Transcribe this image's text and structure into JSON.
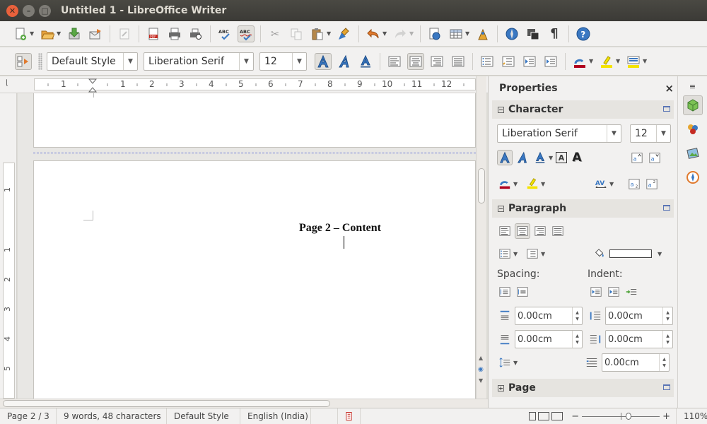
{
  "window": {
    "title": "Untitled 1 - LibreOffice Writer"
  },
  "formatting": {
    "paragraph_style": "Default Style",
    "font_name": "Liberation Serif",
    "font_size": "12"
  },
  "ruler": {
    "h_labels": [
      "1",
      "1",
      "2",
      "3",
      "4",
      "5",
      "6",
      "7",
      "8",
      "9",
      "10",
      "11",
      "12"
    ],
    "v_labels": [
      "1",
      "1",
      "2",
      "3",
      "4",
      "5"
    ]
  },
  "document": {
    "heading": "Page 2 – Content"
  },
  "sidebar": {
    "title": "Properties",
    "close": "×",
    "character": {
      "title": "Character",
      "font_name": "Liberation Serif",
      "font_size": "12"
    },
    "paragraph": {
      "title": "Paragraph",
      "spacing_label": "Spacing:",
      "indent_label": "Indent:",
      "above_spacing": "0.00cm",
      "below_spacing": "0.00cm",
      "before_indent": "0.00cm",
      "after_indent": "0.00cm",
      "first_line_indent": "0.00cm"
    },
    "page": {
      "title": "Page"
    }
  },
  "status": {
    "page": "Page 2 / 3",
    "words": "9 words, 48 characters",
    "style": "Default Style",
    "language": "English (India)",
    "zoom": "110%"
  },
  "colors": {
    "accent": "#e9613c",
    "highlight": "#f5e400",
    "font_color": "#b0001e",
    "page_break": "#6b79d6"
  }
}
